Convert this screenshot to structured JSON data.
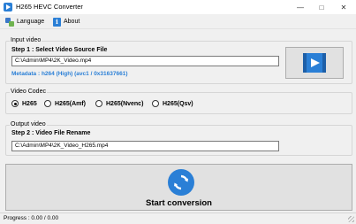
{
  "window": {
    "title": "H265 HEVC Converter"
  },
  "menu": {
    "language_label": "Language",
    "about_label": "About"
  },
  "input_video": {
    "legend": "Input video",
    "step_label": "Step 1 : Select Video Source File",
    "path": "C:\\Admin\\MP4\\2K_Video.mp4",
    "metadata": "Metadata : h264 (High) (avc1 / 0x31637661)"
  },
  "video_codec": {
    "legend": "Video Codec",
    "options": [
      "H265",
      "H265(Amf)",
      "H265(Nvenc)",
      "H265(Qsv)"
    ],
    "selected": "H265"
  },
  "output_video": {
    "legend": "Output video",
    "step_label": "Step 2 : Video File Rename",
    "path": "C:\\Admin\\MP4\\2K_Video_H265.mp4"
  },
  "start_button": {
    "label": "Start conversion"
  },
  "status": {
    "progress": "Progress : 0.00 / 0.00"
  },
  "colors": {
    "accent": "#2a7fd6",
    "background": "#f0f0f0"
  }
}
